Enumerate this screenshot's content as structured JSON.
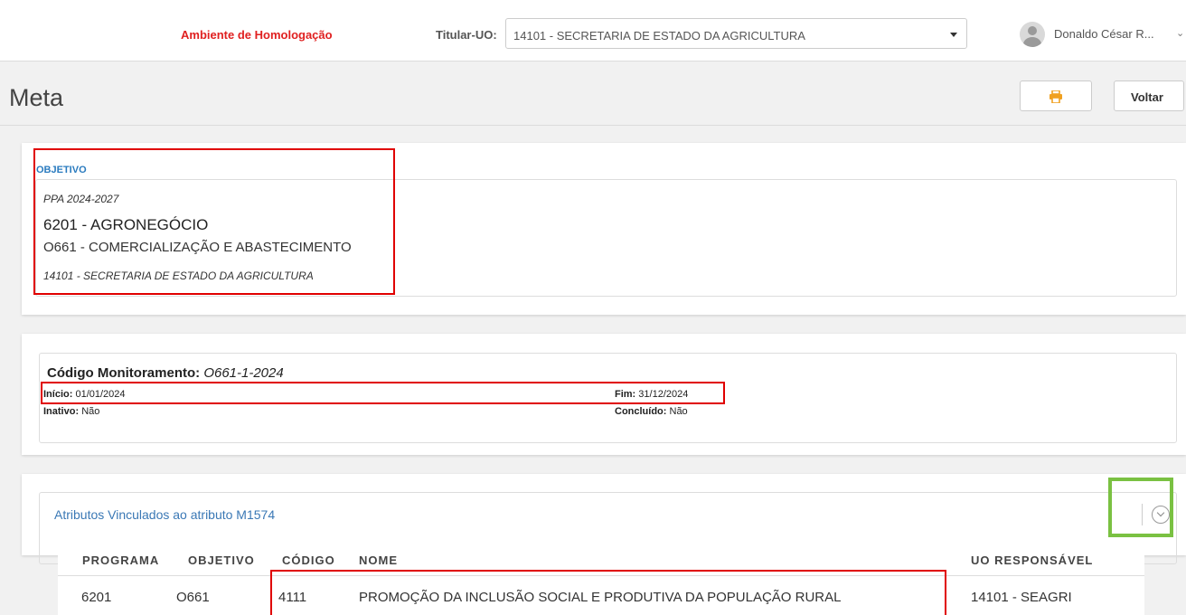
{
  "header": {
    "environment": "Ambiente de Homologação",
    "titular_label": "Titular-UO:",
    "titular_value": "14101 - SECRETARIA DE ESTADO DA AGRICULTURA",
    "user_name": "Donaldo César R...",
    "user_caret": "⌄"
  },
  "page": {
    "title": "Meta",
    "back_label": "Voltar",
    "print_icon": "printer-icon"
  },
  "objective": {
    "label": "OBJETIVO",
    "ppa": "PPA 2024-2027",
    "program_code": "6201",
    "program_name": "AGRONEGÓCIO",
    "objective_line": "O661 - COMERCIALIZAÇÃO E ABASTECIMENTO",
    "uo_line": "14101 - SECRETARIA DE ESTADO DA AGRICULTURA"
  },
  "monitoring": {
    "code_label": "Código Monitoramento:",
    "code_value": "O661-1-2024",
    "inicio_label": "Início:",
    "inicio_value": "01/01/2024",
    "fim_label": "Fim:",
    "fim_value": "31/12/2024",
    "inativo_label": "Inativo:",
    "inativo_value": "Não",
    "concluido_label": "Concluído:",
    "concluido_value": "Não"
  },
  "attributes": {
    "title": "Atributos Vinculados ao atributo M1574",
    "toggle_icon": "chevron-down-circle-icon",
    "columns": [
      "PROGRAMA",
      "OBJETIVO",
      "CÓDIGO",
      "NOME",
      "UO RESPONSÁVEL"
    ],
    "rows": [
      [
        "6201",
        "O661",
        "4111",
        "PROMOÇÃO DA INCLUSÃO SOCIAL E PRODUTIVA DA POPULAÇÃO RURAL",
        "14101 - SEAGRI"
      ]
    ]
  },
  "colors": {
    "environment": "#e02020",
    "link_blue": "#3a78b5",
    "highlight_red": "#e00000",
    "highlight_green": "#7ac142",
    "print_icon": "#f0a020"
  }
}
